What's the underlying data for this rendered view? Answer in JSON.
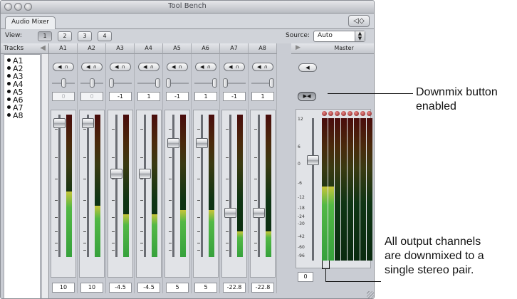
{
  "window": {
    "title": "Tool Bench",
    "tab_label": "Audio Mixer",
    "speaker_button_label": "◁◇"
  },
  "view_bar": {
    "view_label": "View:",
    "view_buttons": [
      "1",
      "2",
      "3",
      "4"
    ],
    "source_label": "Source:",
    "source_value": "Auto"
  },
  "tracks_panel": {
    "header": "Tracks",
    "items": [
      "A1",
      "A2",
      "A3",
      "A4",
      "A5",
      "A6",
      "A7",
      "A8"
    ]
  },
  "channels": [
    {
      "name": "A1",
      "mute_label": "◀ ∩",
      "pan": "0",
      "volume": "10",
      "pan_enabled": false
    },
    {
      "name": "A2",
      "mute_label": "◀ ∩",
      "pan": "0",
      "volume": "10",
      "pan_enabled": false
    },
    {
      "name": "A3",
      "mute_label": "◀ ∩",
      "pan": "-1",
      "volume": "-4.5",
      "pan_enabled": true
    },
    {
      "name": "A4",
      "mute_label": "◀ ∩",
      "pan": "1",
      "volume": "-4.5",
      "pan_enabled": true
    },
    {
      "name": "A5",
      "mute_label": "◀ ∩",
      "pan": "-1",
      "volume": "5",
      "pan_enabled": true
    },
    {
      "name": "A6",
      "mute_label": "◀ ∩",
      "pan": "1",
      "volume": "5",
      "pan_enabled": true
    },
    {
      "name": "A7",
      "mute_label": "◀ ∩",
      "pan": "-1",
      "volume": "-22.8",
      "pan_enabled": true
    },
    {
      "name": "A8",
      "mute_label": "◀ ∩",
      "pan": "1",
      "volume": "-22.8",
      "pan_enabled": true
    }
  ],
  "channel_meter_levels": [
    0.46,
    0.36,
    0.3,
    0.3,
    0.33,
    0.33,
    0.18,
    0.18
  ],
  "master": {
    "header": "Master",
    "mute_label": "◀",
    "downmix_label": "▶◀",
    "volume": "0",
    "scale": [
      "12",
      "6",
      "0",
      "-6",
      "-12",
      "-18",
      "-24",
      "-30",
      "-42",
      "-60",
      "-96"
    ],
    "meter_levels": [
      0.52,
      0.52,
      0,
      0,
      0,
      0,
      0,
      0
    ]
  },
  "callouts": {
    "downmix": "Downmix button enabled",
    "downmix_line1": "Downmix button",
    "downmix_line2": "enabled",
    "output_line1": "All output channels",
    "output_line2": "are downmixed to a",
    "output_line3": "single stereo pair."
  },
  "colors": {
    "window_bg": "#c9ccd3",
    "meter_green": "#36a13c",
    "meter_red": "#4a0c0c",
    "clip_red": "#7a1a1a"
  }
}
